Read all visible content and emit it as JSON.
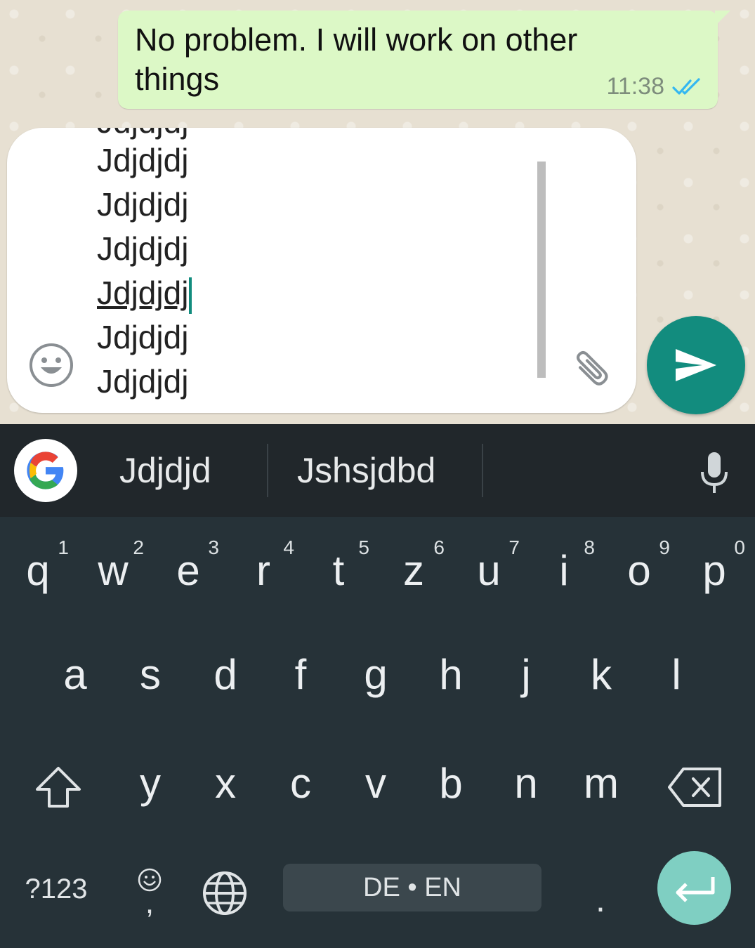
{
  "chat": {
    "outgoing_message": {
      "text": "No problem. I will work on other things",
      "time": "11:38",
      "status": "read",
      "bubble_color": "#dcf8c6",
      "tick_color": "#34b7f1"
    }
  },
  "composer": {
    "lines": [
      "Jdjdjdj",
      "Jdjdjdj",
      "Jdjdjdj",
      "Jdjdjdj",
      "Jdjdjdj",
      "Jdjdjdj"
    ],
    "active_line": "Jdjdjdj",
    "emoji_icon": "smiley-icon",
    "attach_icon": "paperclip-icon",
    "send_icon": "send-arrow-icon",
    "accent": "#128c7e"
  },
  "suggestions": {
    "google_icon": "google-g-icon",
    "items": [
      "Jdjdjd",
      "Jshsjdbd"
    ],
    "mic_icon": "microphone-icon"
  },
  "keyboard": {
    "row1": [
      {
        "key": "q",
        "hint": "1"
      },
      {
        "key": "w",
        "hint": "2"
      },
      {
        "key": "e",
        "hint": "3"
      },
      {
        "key": "r",
        "hint": "4"
      },
      {
        "key": "t",
        "hint": "5"
      },
      {
        "key": "z",
        "hint": "6"
      },
      {
        "key": "u",
        "hint": "7"
      },
      {
        "key": "i",
        "hint": "8"
      },
      {
        "key": "o",
        "hint": "9"
      },
      {
        "key": "p",
        "hint": "0"
      }
    ],
    "row2": [
      "a",
      "s",
      "d",
      "f",
      "g",
      "h",
      "j",
      "k",
      "l"
    ],
    "row3": [
      "y",
      "x",
      "c",
      "v",
      "b",
      "n",
      "m"
    ],
    "symbols_label": "?123",
    "comma_label": ",",
    "period_label": ".",
    "space_label": "DE • EN",
    "shift_icon": "shift-icon",
    "backspace_icon": "backspace-icon",
    "emoji_icon": "emoji-icon",
    "globe_icon": "globe-icon",
    "enter_icon": "enter-icon",
    "background": "#263238",
    "enter_color": "#7fcfc2"
  }
}
